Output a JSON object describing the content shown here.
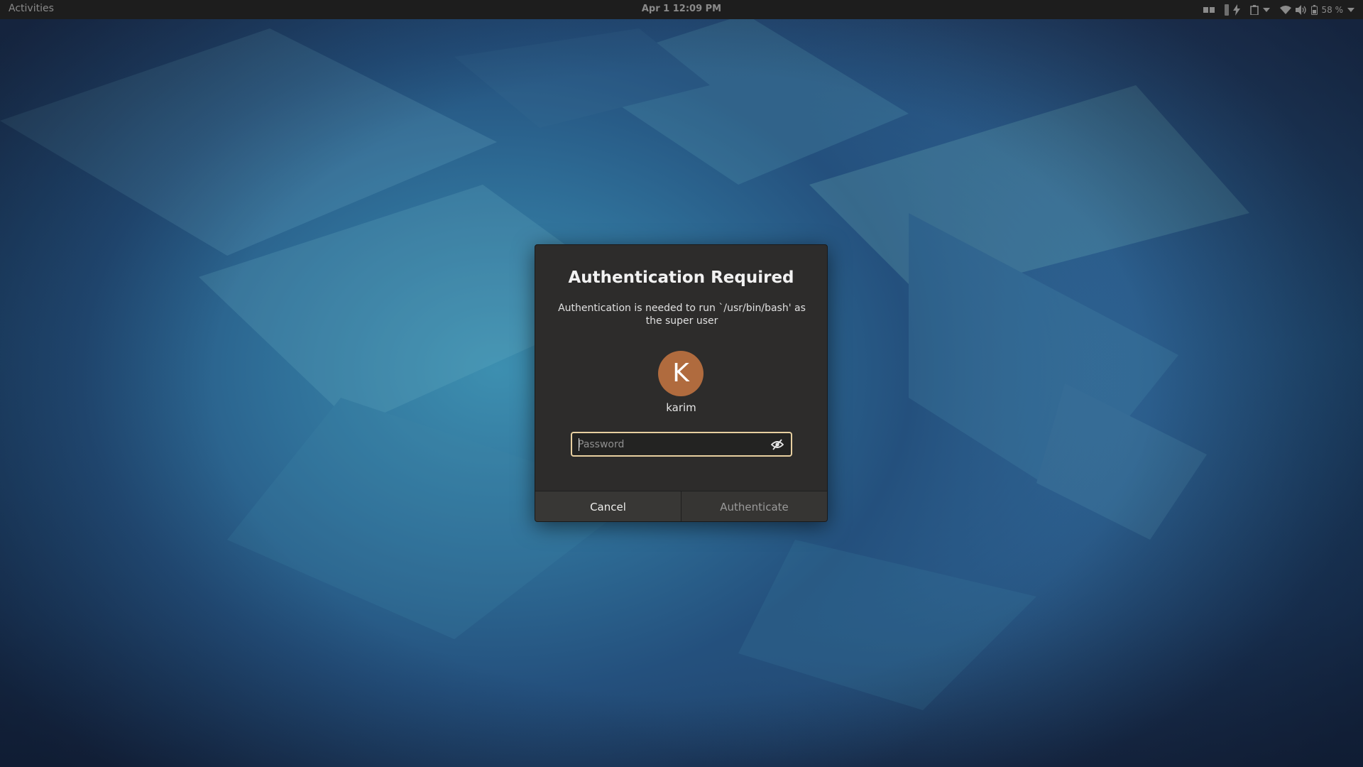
{
  "topbar": {
    "activities": "Activities",
    "clock": "Apr 1  12:09 PM",
    "battery_text": "58 %",
    "tray_icons": [
      "workspace-icon",
      "vertical-bar-icon",
      "flash-icon",
      "clipboard-icon",
      "chevron-down-icon",
      "wifi-icon",
      "volume-icon",
      "battery-icon",
      "chevron-down-icon"
    ]
  },
  "dialog": {
    "title": "Authentication Required",
    "description": "Authentication is needed to run `/usr/bin/bash' as the super user",
    "avatar_initial": "K",
    "avatar_color": "#b06b3e",
    "username": "karim",
    "password": {
      "value": "",
      "placeholder": "Password"
    },
    "focus_color": "#e7cfa0",
    "cancel_label": "Cancel",
    "authenticate_label": "Authenticate"
  }
}
